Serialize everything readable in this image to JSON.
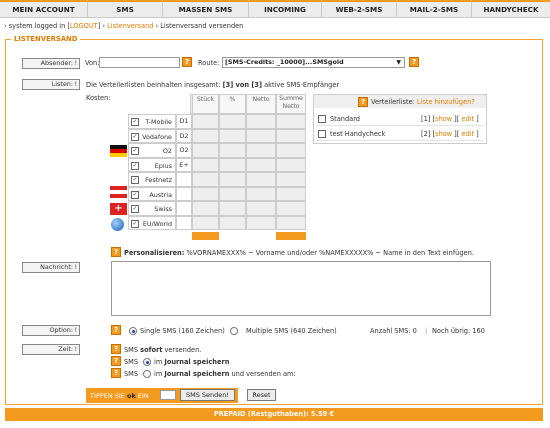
{
  "nav": {
    "tabs": [
      "MEIN ACCOUNT",
      "SMS",
      "MASSEN SMS",
      "INCOMING",
      "WEB-2-SMS",
      "MAIL-2-SMS",
      "HANDYCHECK"
    ]
  },
  "breadcrumb": {
    "prefix": "› system logged in [",
    "logout": "LOGOUT",
    "mid": "] › ",
    "listversand": "Listenversand",
    "current": " › Listenversand versenden"
  },
  "fieldset": {
    "legend": "LISTENVERSAND"
  },
  "absender": {
    "label": "Absender:",
    "von_label": "Von:",
    "von_value": "",
    "route_label": "Route:",
    "route_value": "[SMS-Credits: _10000]...SMSgold"
  },
  "listen": {
    "label": "Listen:",
    "summary_pre": "Die Verteilerlisten beinhalten insgesamt: ",
    "summary_bold": "[3] von [3]",
    "summary_post": " aktive SMS-Empfänger",
    "kosten": "Kosten:",
    "columns": [
      "Stück",
      "%",
      "Netto",
      "Summe Netto"
    ],
    "networks": [
      {
        "name": "T-Mobile",
        "code": "D1"
      },
      {
        "name": "Vodafone",
        "code": "D2"
      },
      {
        "name": "O2",
        "code": "O2"
      },
      {
        "name": "Eplus",
        "code": "E+"
      },
      {
        "name": "Festnetz",
        "code": ""
      },
      {
        "name": "Austria",
        "code": ""
      },
      {
        "name": "Swiss",
        "code": ""
      },
      {
        "name": "EU/World",
        "code": ""
      }
    ],
    "verteiler": {
      "title": "Verteilerliste:",
      "add_link": "Liste hinzufügen?",
      "items": [
        {
          "name": "Standard",
          "count": "[1]",
          "show": "show",
          "edit": "edit"
        },
        {
          "name": "test Handycheck",
          "count": "[2]",
          "show": "show",
          "edit": "edit"
        }
      ]
    }
  },
  "nachricht": {
    "label": "Nachricht:",
    "personalize_bold": "Personalisieren:",
    "personalize_text": " %VORNAMEXXX% ~ Vorname und/oder %NAMEXXXXX% ~ Name in den Text einfügen."
  },
  "option": {
    "label": "Option:",
    "single": "Single SMS (160 Zeichen)",
    "multiple": "Multiple SMS (640 Zeichen)",
    "anzahl": "Anzahl SMS: 0",
    "noch": "Noch übrig: 160"
  },
  "zeit": {
    "label": "Zeit:",
    "sofort_pre": "SMS ",
    "sofort_bold": "sofort",
    "sofort_post": " versenden.",
    "journal_pre": "SMS ",
    "journal_mid": "im ",
    "journal_bold": "Journal speichern",
    "journal2_bold": "Journal speichern",
    "journal2_post": " und versenden am:"
  },
  "submit": {
    "tippen": "TIPPEN SIE",
    "ok": "ok",
    "ein": "EIN",
    "send": "SMS Senden!",
    "reset": "Reset"
  },
  "footer": {
    "prepaid": "PREPAID (Restguthaben): 5.59 €"
  }
}
